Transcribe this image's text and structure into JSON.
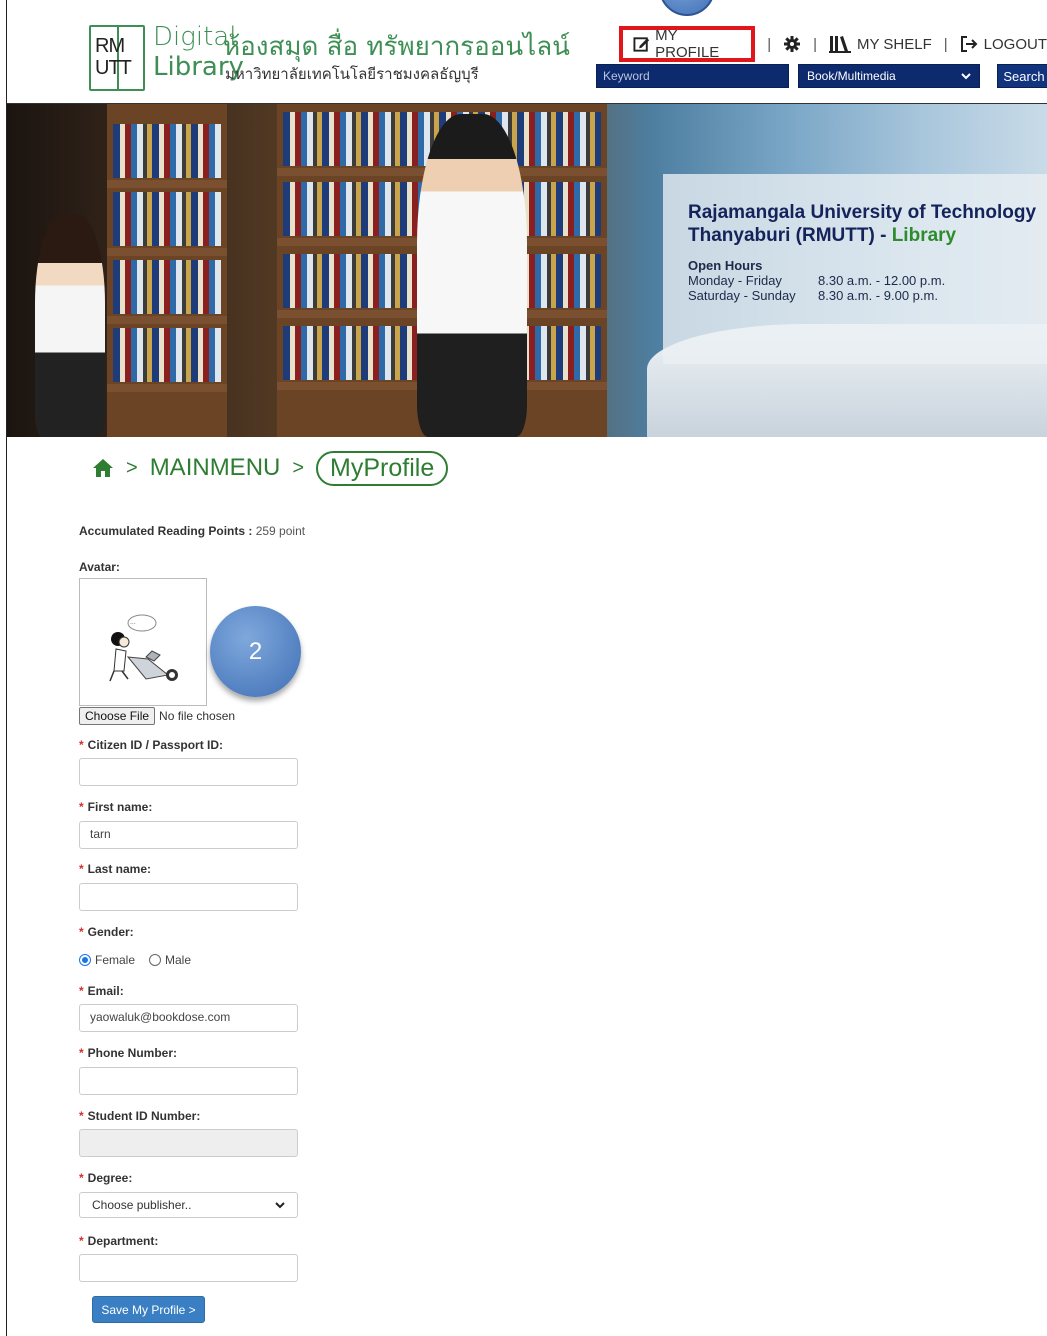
{
  "header": {
    "logo": {
      "rm": "RM",
      "utt": "UTT",
      "digital": "Digital",
      "library": "Library"
    },
    "site_title": "ห้องสมุด สื่อ ทรัพยากรออนไลน์",
    "site_subtitle": "มหาวิทยาลัยเทคโนโลยีราชมงคลธัญบุรี",
    "nav": {
      "my_profile": "MY PROFILE",
      "separator": "|",
      "my_shelf": "MY SHELF",
      "logout": "LOGOUT"
    },
    "search": {
      "keyword_placeholder": "Keyword",
      "category_selected": "Book/Multimedia",
      "button": "Search"
    }
  },
  "banner": {
    "title_line1": "Rajamangala University of Technology",
    "title_line2": "Thanyaburi (RMUTT) - ",
    "title_library": "Library",
    "hours_heading": "Open Hours",
    "hours": [
      {
        "days": "Monday - Friday",
        "time": "8.30 a.m. - 12.00 p.m."
      },
      {
        "days": "Saturday - Sunday",
        "time": "8.30 a.m. - 9.00 p.m."
      }
    ]
  },
  "breadcrumb": {
    "separator": ">",
    "mainmenu": "MAINMENU",
    "current": "MyProfile"
  },
  "form": {
    "points_label": "Accumulated Reading Points : ",
    "points_value": "259 point",
    "avatar_label": "Avatar:",
    "step_marker": "2",
    "file_button": "Choose File",
    "file_status": "No file chosen",
    "required_mark": "*",
    "citizen_id_label": "Citizen ID / Passport ID:",
    "citizen_id_value": "",
    "first_name_label": "First name:",
    "first_name_value": "tarn",
    "last_name_label": "Last name:",
    "last_name_value": "",
    "gender_label": "Gender:",
    "gender_options": [
      "Female",
      "Male"
    ],
    "gender_selected": "Female",
    "email_label": "Email:",
    "email_value": "yaowaluk@bookdose.com",
    "phone_label": "Phone Number:",
    "phone_value": "",
    "student_id_label": "Student ID Number:",
    "student_id_value": "",
    "degree_label": "Degree:",
    "degree_selected": "Choose publisher..",
    "department_label": "Department:",
    "department_value": "",
    "save_button": "Save My Profile >"
  },
  "colors": {
    "highlight_border": "#e0161b",
    "brand_green": "#3e8f55",
    "search_navy": "#0d2a6e",
    "step_blue": "#3f6fb5",
    "save_blue": "#3a7fc3"
  }
}
